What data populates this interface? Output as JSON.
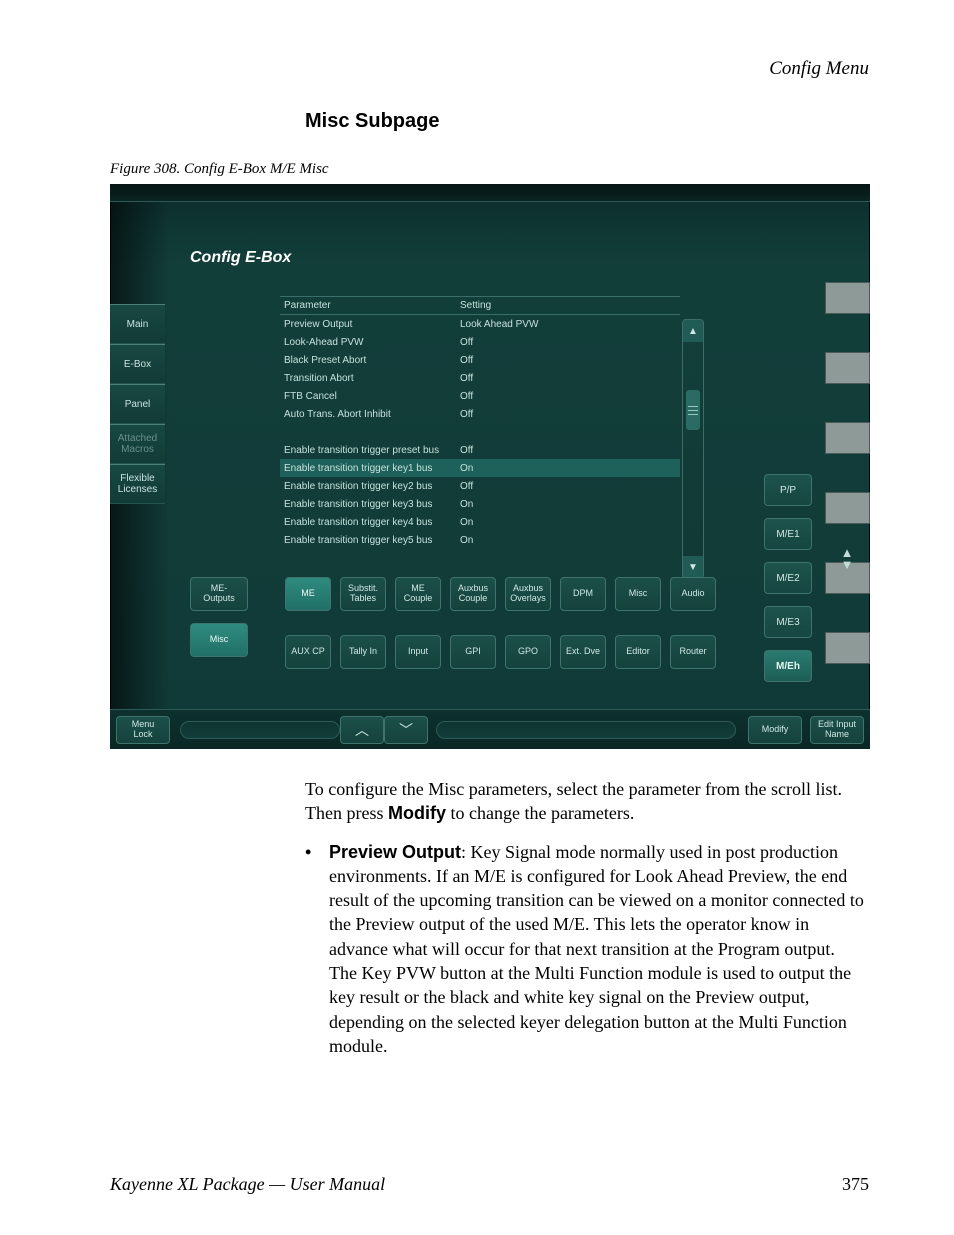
{
  "header": {
    "section": "Config Menu"
  },
  "title": "Misc Subpage",
  "figure_caption": "Figure 308.  Config E-Box M/E Misc",
  "panel": {
    "title": "Config E-Box",
    "columns": {
      "param": "Parameter",
      "setting": "Setting"
    },
    "rows": [
      {
        "param": "Preview Output",
        "setting": "Look Ahead PVW"
      },
      {
        "param": "Look-Ahead PVW",
        "setting": "Off"
      },
      {
        "param": "Black Preset Abort",
        "setting": "Off"
      },
      {
        "param": "Transition Abort",
        "setting": "Off"
      },
      {
        "param": "FTB Cancel",
        "setting": "Off"
      },
      {
        "param": "Auto Trans. Abort Inhibit",
        "setting": "Off"
      }
    ],
    "rows2": [
      {
        "param": "Enable transition trigger preset bus",
        "setting": "Off"
      },
      {
        "param": "Enable transition trigger key1 bus",
        "setting": "On",
        "selected": true
      },
      {
        "param": "Enable transition trigger key2 bus",
        "setting": "Off"
      },
      {
        "param": "Enable transition trigger key3 bus",
        "setting": "On"
      },
      {
        "param": "Enable transition trigger key4 bus",
        "setting": "On"
      },
      {
        "param": "Enable transition trigger key5 bus",
        "setting": "On"
      }
    ],
    "left_tabs": [
      {
        "label": "Main"
      },
      {
        "label": "E-Box"
      },
      {
        "label": "Panel"
      },
      {
        "label": "Attached Macros",
        "disabled": true
      },
      {
        "label": "Flexible Licenses"
      }
    ],
    "right_nav": [
      {
        "label": "P/P"
      },
      {
        "label": "M/E1"
      },
      {
        "label": "M/E2"
      },
      {
        "label": "M/E3"
      },
      {
        "label": "M/Eh",
        "hl": true
      }
    ],
    "sub_left": [
      {
        "label": "ME-\nOutputs"
      },
      {
        "label": "Misc",
        "selected": true
      }
    ],
    "grid_row1": [
      {
        "label": "ME",
        "selected": true
      },
      {
        "label": "Substit. Tables"
      },
      {
        "label": "ME Couple"
      },
      {
        "label": "Auxbus Couple"
      },
      {
        "label": "Auxbus Overlays"
      },
      {
        "label": "DPM"
      },
      {
        "label": "Misc"
      },
      {
        "label": "Audio"
      }
    ],
    "grid_row2": [
      {
        "label": "AUX CP"
      },
      {
        "label": "Tally In"
      },
      {
        "label": "Input"
      },
      {
        "label": "GPI"
      },
      {
        "label": "GPO"
      },
      {
        "label": "Ext. Dve"
      },
      {
        "label": "Editor"
      },
      {
        "label": "Router"
      }
    ],
    "bottom": {
      "menu_lock": "Menu\nLock",
      "modify": "Modify",
      "edit_input_name": "Edit Input\nName"
    }
  },
  "body": {
    "para1_a": "To configure the Misc parameters, select the parameter from the scroll list. Then press ",
    "para1_bold": "Modify",
    "para1_b": " to change the parameters.",
    "bullet_lead_bold": "Preview Output",
    "bullet_rest": ": Key Signal mode normally used in post production environments. If an M/E is configured for Look Ahead Preview, the end result of the upcoming transition can be viewed on a monitor connected to the Preview output of the used M/E. This lets the operator know in advance what will occur for that next transition at the Program output. The Key PVW button at the Multi Function module is used to output the key result or the black and white key signal on the Preview output, depending on the selected keyer delegation button at the Multi Function module."
  },
  "footer": {
    "left": "Kayenne XL Package — User Manual",
    "page": "375"
  }
}
